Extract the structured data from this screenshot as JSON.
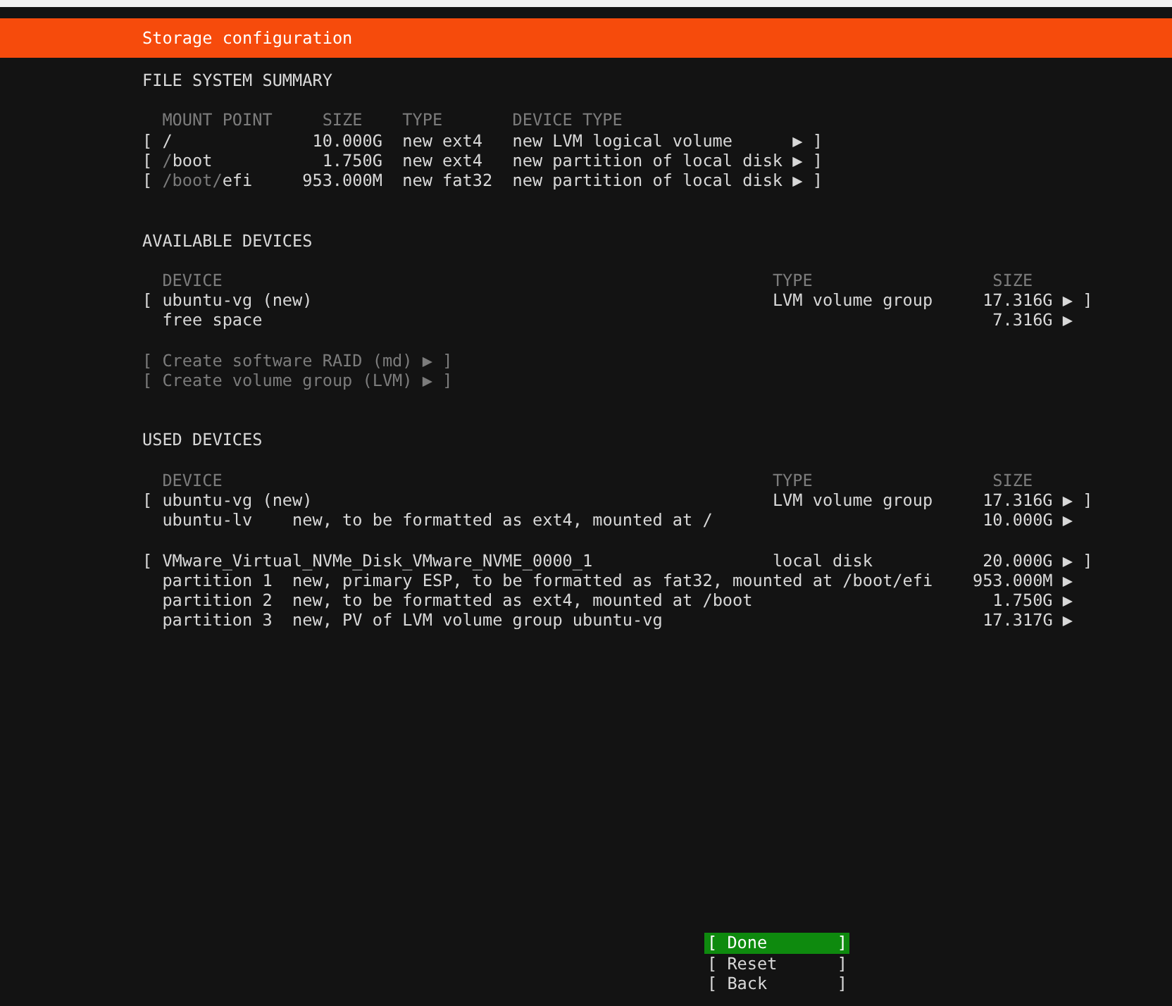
{
  "title_bar": {
    "title": "Storage configuration"
  },
  "file_system_summary": {
    "heading": "FILE SYSTEM SUMMARY",
    "columns": [
      "MOUNT POINT",
      "SIZE",
      "TYPE",
      "DEVICE TYPE"
    ],
    "rows": [
      {
        "open": "[",
        "mount_point": [
          {
            "text": "/",
            "dim": false
          }
        ],
        "size": "10.000G",
        "type": "new ext4",
        "device_type": "new LVM logical volume",
        "arrow": "▶",
        "close": "]"
      },
      {
        "open": "[",
        "mount_point": [
          {
            "text": "/",
            "dim": true
          },
          {
            "text": "boot",
            "dim": false
          }
        ],
        "size": "1.750G",
        "type": "new ext4",
        "device_type": "new partition of local disk",
        "arrow": "▶",
        "close": "]"
      },
      {
        "open": "[",
        "mount_point": [
          {
            "text": "/boot/",
            "dim": true
          },
          {
            "text": "efi",
            "dim": false
          }
        ],
        "size": "953.000M",
        "type": "new fat32",
        "device_type": "new partition of local disk",
        "arrow": "▶",
        "close": "]"
      }
    ]
  },
  "available_devices": {
    "heading": "AVAILABLE DEVICES",
    "columns": [
      "DEVICE",
      "TYPE",
      "SIZE"
    ],
    "devices": [
      {
        "open": "[",
        "name": "ubuntu-vg (new)",
        "type": "LVM volume group",
        "size": "17.316G",
        "arrow": "▶",
        "close": "]",
        "children": [
          {
            "name": "free space",
            "size": "7.316G",
            "arrow": "▶"
          }
        ]
      }
    ],
    "actions": [
      {
        "open": "[",
        "label": "Create software RAID (md)",
        "arrow": "▶",
        "close": "]",
        "disabled": true
      },
      {
        "open": "[",
        "label": "Create volume group (LVM)",
        "arrow": "▶",
        "close": "]",
        "disabled": true
      }
    ]
  },
  "used_devices": {
    "heading": "USED DEVICES",
    "columns": [
      "DEVICE",
      "TYPE",
      "SIZE"
    ],
    "devices": [
      {
        "open": "[",
        "name": "ubuntu-vg (new)",
        "type": "LVM volume group",
        "size": "17.316G",
        "arrow": "▶",
        "close": "]",
        "children": [
          {
            "name": "ubuntu-lv",
            "description": "new, to be formatted as ext4, mounted at /",
            "size": "10.000G",
            "arrow": "▶"
          }
        ]
      },
      {
        "open": "[",
        "name": "VMware_Virtual_NVMe_Disk_VMware_NVME_0000_1",
        "type": "local disk",
        "size": "20.000G",
        "arrow": "▶",
        "close": "]",
        "children": [
          {
            "name": "partition 1",
            "description": "new, primary ESP, to be formatted as fat32, mounted at /boot/efi",
            "size": "953.000M",
            "arrow": "▶"
          },
          {
            "name": "partition 2",
            "description": "new, to be formatted as ext4, mounted at /boot",
            "size": "1.750G",
            "arrow": "▶"
          },
          {
            "name": "partition 3",
            "description": "new, PV of LVM volume group ubuntu-vg",
            "size": "17.317G",
            "arrow": "▶"
          }
        ]
      }
    ]
  },
  "buttons": [
    {
      "open": "[",
      "label": "Done",
      "close": "]",
      "selected": true
    },
    {
      "open": "[",
      "label": "Reset",
      "close": "]",
      "selected": false
    },
    {
      "open": "[",
      "label": "Back",
      "close": "]",
      "selected": false
    }
  ]
}
